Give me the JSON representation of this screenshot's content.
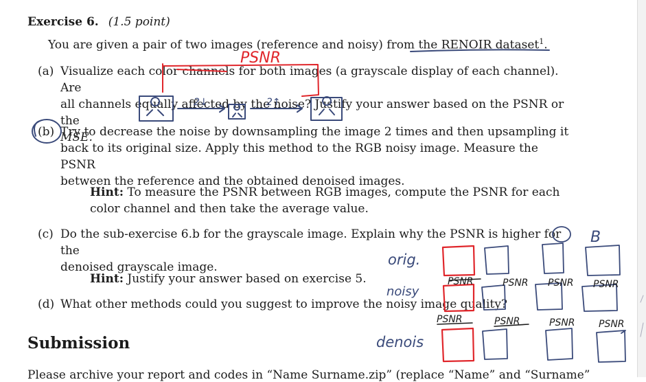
{
  "exercise": {
    "title": "Exercise 6.",
    "points": "(1.5 point)",
    "intro": "You are given a pair of two images (reference and noisy) from the RENOIR dataset",
    "footnote_mark": "1",
    "intro_end": "."
  },
  "items": [
    {
      "label": "(a)",
      "lines": [
        "Visualize each color channels for both images (a grayscale display of each channel). Are",
        "all channels equally affected by the noise? Justify your answer based on the PSNR or the",
        "MSE."
      ]
    },
    {
      "label": "(b)",
      "lines": [
        "Try to decrease the noise by downsampling the image 2 times and then upsampling it",
        "back to its original size. Apply this method to the RGB noisy image. Measure the PSNR",
        "between the reference and the obtained denoised images."
      ]
    },
    {
      "label": "(c)",
      "lines": [
        "Do the sub-exercise 6.b for the grayscale image. Explain why the PSNR is higher for the",
        "denoised grayscale image."
      ]
    },
    {
      "label": "(d)",
      "lines": [
        "What other methods could you suggest to improve the noisy image quality?"
      ]
    }
  ],
  "hints": [
    {
      "bold": "Hint:",
      "lines": [
        "To measure the PSNR between RGB images, compute the PSNR for each",
        "color channel and then take the average value."
      ]
    },
    {
      "bold": "Hint:",
      "lines": [
        "Justify your answer based on exercise 5."
      ]
    }
  ],
  "submission": {
    "heading": "Submission",
    "cutoff_line": "Please archive your report and codes in “Name Surname.zip” (replace “Name” and “Surname”"
  },
  "annotations": {
    "psnr_top": "PSNR",
    "down": "2↓",
    "up": "2↑",
    "orig": "orig.",
    "noisy": "noisy",
    "denois": "denois",
    "channel_b": "B",
    "psnr_row": [
      "PSNR",
      "PSNR",
      "PSNR",
      "PSNR"
    ],
    "psnr_row2": [
      "PSNR",
      "PSNR",
      "PSNR",
      "PSNR"
    ],
    "ink_red": "#e0262b",
    "ink_blue": "#3a4a7a"
  }
}
